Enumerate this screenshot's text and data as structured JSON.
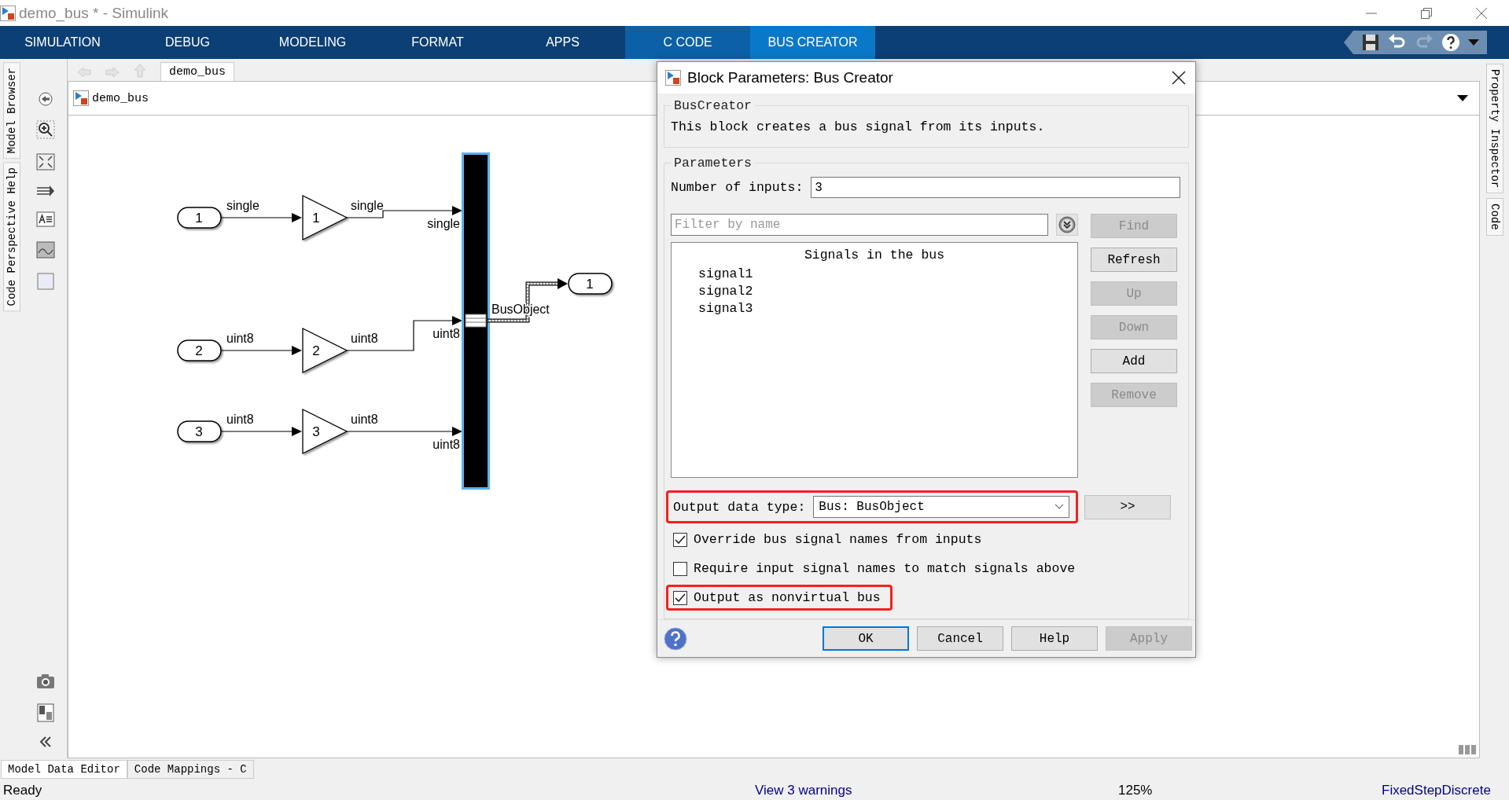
{
  "window": {
    "title": "demo_bus * - Simulink"
  },
  "ribbon": {
    "tabs": [
      {
        "label": "SIMULATION",
        "selected": false,
        "contextual": false
      },
      {
        "label": "DEBUG",
        "selected": false,
        "contextual": false
      },
      {
        "label": "MODELING",
        "selected": false,
        "contextual": false
      },
      {
        "label": "FORMAT",
        "selected": false,
        "contextual": false
      },
      {
        "label": "APPS",
        "selected": false,
        "contextual": false
      },
      {
        "label": "C CODE",
        "selected": false,
        "contextual": true
      },
      {
        "label": "BUS CREATOR",
        "selected": true,
        "contextual": true
      }
    ]
  },
  "left_panel_tabs": [
    "Model Browser",
    "Code Perspective Help"
  ],
  "right_panel_tabs": [
    "Property Inspector",
    "Code"
  ],
  "breadcrumb": {
    "tab": "demo_bus"
  },
  "address": {
    "model": "demo_bus"
  },
  "diagram": {
    "rows": [
      {
        "inport": "1",
        "in_label": "single",
        "gain": "1",
        "out_label": "single",
        "bus_label": "single"
      },
      {
        "inport": "2",
        "in_label": "uint8",
        "gain": "2",
        "out_label": "uint8",
        "bus_label": "uint8"
      },
      {
        "inport": "3",
        "in_label": "uint8",
        "gain": "3",
        "out_label": "uint8",
        "bus_label": "uint8"
      }
    ],
    "bus_selected": true,
    "bus_output_label": "BusObject",
    "outport": "1"
  },
  "dialog": {
    "title": "Block Parameters: Bus Creator",
    "block_type": "BusCreator",
    "description": "This block creates a bus signal from its inputs.",
    "parameters_title": "Parameters",
    "number_of_inputs": {
      "label": "Number of inputs:",
      "value": "3"
    },
    "filter": {
      "placeholder": "Filter by name"
    },
    "signals_heading": "Signals in the bus",
    "signals": [
      "signal1",
      "signal2",
      "signal3"
    ],
    "side_buttons": [
      {
        "label": "Find",
        "disabled": true
      },
      {
        "label": "Refresh",
        "disabled": false
      },
      {
        "label": "Up",
        "disabled": true
      },
      {
        "label": "Down",
        "disabled": true
      },
      {
        "label": "Add",
        "disabled": false
      },
      {
        "label": "Remove",
        "disabled": true
      }
    ],
    "output_data_type": {
      "label": "Output data type:",
      "value": "Bus: BusObject",
      "highlighted": true,
      "assistant_button": ">>"
    },
    "checkboxes": [
      {
        "label": "Override bus signal names from inputs",
        "checked": true,
        "highlighted": false
      },
      {
        "label": "Require input signal names to match signals above",
        "checked": false,
        "highlighted": false
      },
      {
        "label": "Output as nonvirtual bus",
        "checked": true,
        "highlighted": true
      }
    ],
    "buttons": [
      {
        "label": "OK",
        "disabled": false,
        "default": true
      },
      {
        "label": "Cancel",
        "disabled": false,
        "default": false
      },
      {
        "label": "Help",
        "disabled": false,
        "default": false
      },
      {
        "label": "Apply",
        "disabled": true,
        "default": false
      }
    ]
  },
  "bottom_tabs": [
    "Model Data Editor",
    "Code Mappings - C"
  ],
  "status_bar": {
    "state": "Ready",
    "warnings": "View 3 warnings",
    "zoom": "125%",
    "solver": "FixedStepDiscrete"
  }
}
